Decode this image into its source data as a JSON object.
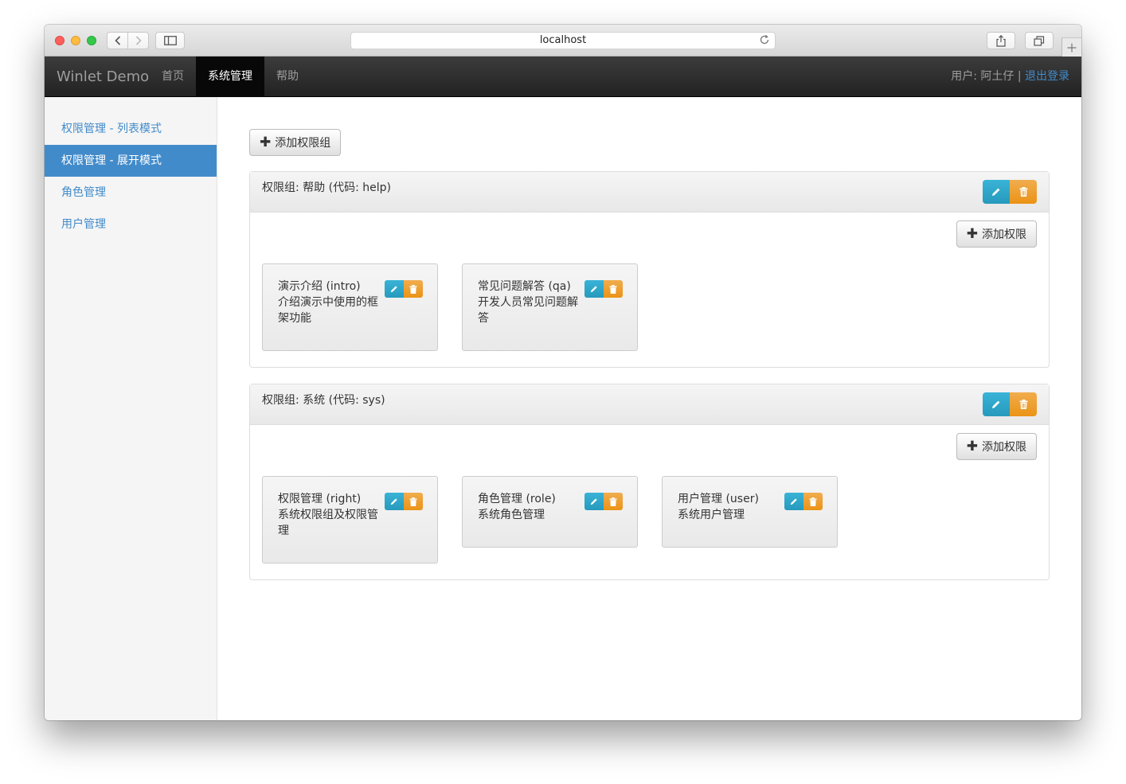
{
  "browser": {
    "url": "localhost"
  },
  "navbar": {
    "brand": "Winlet Demo",
    "items": [
      {
        "label": "首页"
      },
      {
        "label": "系统管理"
      },
      {
        "label": "帮助"
      }
    ],
    "user_label": "用户:",
    "user_name": "阿土仔",
    "separator": "|",
    "logout_label": "退出登录"
  },
  "sidebar": {
    "items": [
      {
        "label": "权限管理 - 列表模式"
      },
      {
        "label": "权限管理 - 展开模式"
      },
      {
        "label": "角色管理"
      },
      {
        "label": "用户管理"
      }
    ]
  },
  "main": {
    "add_group_label": "添加权限组",
    "add_permission_label": "添加权限",
    "groups": [
      {
        "header": "权限组: 帮助 (代码: help)",
        "permissions": [
          {
            "title": "演示介绍 (intro)",
            "description": "介绍演示中使用的框架功能"
          },
          {
            "title": "常见问题解答 (qa)",
            "description": "开发人员常见问题解答"
          }
        ]
      },
      {
        "header": "权限组: 系统 (代码: sys)",
        "permissions": [
          {
            "title": "权限管理 (right)",
            "description": "系统权限组及权限管理"
          },
          {
            "title": "角色管理 (role)",
            "description": "系统角色管理"
          },
          {
            "title": "用户管理 (user)",
            "description": "系统用户管理"
          }
        ]
      }
    ]
  },
  "colors": {
    "accent": "#428bca",
    "edit": "#31b0d5",
    "delete": "#f0ad4e",
    "navbar": "#222222"
  }
}
